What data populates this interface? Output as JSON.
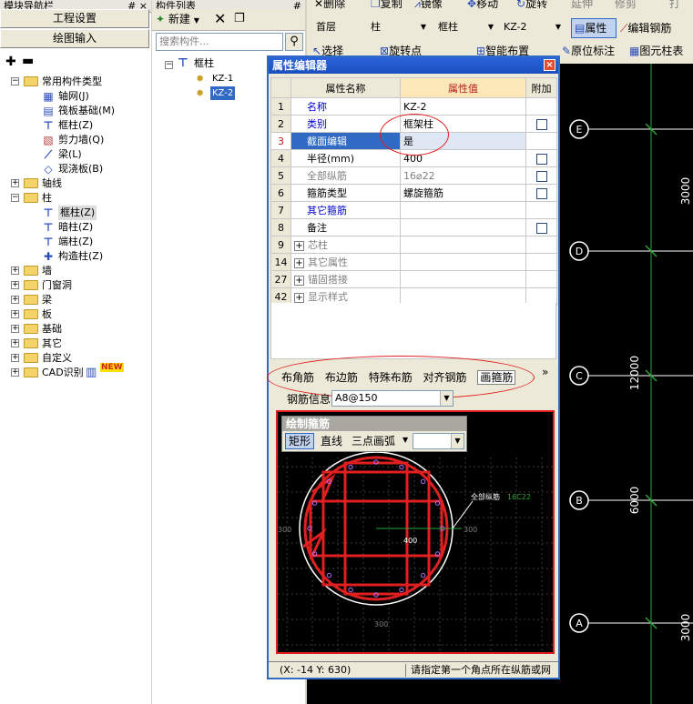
{
  "left_panel": {
    "title": "模块导航栏",
    "pin": "# ×",
    "buttons": [
      "工程设置",
      "绘图输入"
    ],
    "tree": [
      {
        "label": "常用构件类型",
        "level": 0,
        "folder": true,
        "expanded": true
      },
      {
        "label": "轴网(J)",
        "level": 1,
        "icon": "grid-icon"
      },
      {
        "label": "筏板基础(M)",
        "level": 1,
        "icon": "raft-foundation-icon"
      },
      {
        "label": "框柱(Z)",
        "level": 1,
        "icon": "frame-column-icon"
      },
      {
        "label": "剪力墙(Q)",
        "level": 1,
        "icon": "shear-wall-icon"
      },
      {
        "label": "梁(L)",
        "level": 1,
        "icon": "beam-icon"
      },
      {
        "label": "现浇板(B)",
        "level": 1,
        "icon": "slab-icon"
      },
      {
        "label": "轴线",
        "level": 0,
        "folder": true,
        "expanded": false
      },
      {
        "label": "柱",
        "level": 0,
        "folder": true,
        "expanded": true
      },
      {
        "label": "框柱(Z)",
        "level": 1,
        "icon": "frame-column-icon",
        "selected": true
      },
      {
        "label": "暗柱(Z)",
        "level": 1,
        "icon": "hidden-column-icon"
      },
      {
        "label": "端柱(Z)",
        "level": 1,
        "icon": "end-column-icon"
      },
      {
        "label": "构造柱(Z)",
        "level": 1,
        "icon": "constructional-column-icon"
      },
      {
        "label": "墙",
        "level": 0,
        "folder": true,
        "expanded": false
      },
      {
        "label": "门窗洞",
        "level": 0,
        "folder": true,
        "expanded": false
      },
      {
        "label": "梁",
        "level": 0,
        "folder": true,
        "expanded": false
      },
      {
        "label": "板",
        "level": 0,
        "folder": true,
        "expanded": false
      },
      {
        "label": "基础",
        "level": 0,
        "folder": true,
        "expanded": false
      },
      {
        "label": "其它",
        "level": 0,
        "folder": true,
        "expanded": false
      },
      {
        "label": "自定义",
        "level": 0,
        "folder": true,
        "expanded": false
      },
      {
        "label": "CAD识别",
        "level": 0,
        "folder": true,
        "expanded": false,
        "badge": "NEW"
      }
    ]
  },
  "component_list": {
    "title": "构件列表",
    "new_label": "新建",
    "search_placeholder": "搜索构件...",
    "root": "框柱",
    "items": [
      "KZ-1",
      "KZ-2"
    ]
  },
  "top_toolbar": {
    "row1": [
      "删除",
      "复制",
      "镜像",
      "移动",
      "旋转",
      "延伸",
      "修剪",
      "打"
    ],
    "floor": "首层",
    "category": "柱",
    "type": "框柱",
    "component": "KZ-2",
    "property_btn": "属性",
    "edit_rebar_btn": "编辑钢筋",
    "row3": [
      "选择",
      "旋转点",
      "智能布置",
      "原位标注",
      "图元柱表"
    ]
  },
  "property_editor": {
    "title": "属性编辑器",
    "close": "×",
    "headers": [
      "属性名称",
      "属性值",
      "附加"
    ],
    "rows": [
      {
        "num": "1",
        "name": "名称",
        "value": "KZ-2",
        "style": "blue",
        "check": false
      },
      {
        "num": "2",
        "name": "类别",
        "value": "框架柱",
        "style": "blue",
        "check": true
      },
      {
        "num": "3",
        "name": "截面编辑",
        "value": "是",
        "style": "selected",
        "check": false
      },
      {
        "num": "4",
        "name": "半径(mm)",
        "value": "400",
        "style": "normal",
        "check": true
      },
      {
        "num": "5",
        "name": "全部纵筋",
        "value": "16⌀22",
        "style": "gray",
        "check": true
      },
      {
        "num": "6",
        "name": "箍筋类型",
        "value": "螺旋箍筋",
        "style": "normal",
        "check": true
      },
      {
        "num": "7",
        "name": "其它箍筋",
        "value": "",
        "style": "blue",
        "check": false
      },
      {
        "num": "8",
        "name": "备注",
        "value": "",
        "style": "normal",
        "check": true
      },
      {
        "num": "9",
        "name": "芯柱",
        "value": "",
        "style": "group",
        "check": false
      },
      {
        "num": "14",
        "name": "其它属性",
        "value": "",
        "style": "group",
        "check": false
      },
      {
        "num": "27",
        "name": "锚固搭接",
        "value": "",
        "style": "group",
        "check": false
      },
      {
        "num": "42",
        "name": "显示样式",
        "value": "",
        "style": "group",
        "check": false
      }
    ],
    "tabs": [
      "布角筋",
      "布边筋",
      "特殊布筋",
      "对齐钢筋",
      "画箍筋"
    ],
    "more": "»",
    "rebar_info_label": "钢筋信息",
    "rebar_info_value": "A8@150",
    "draw_panel_title": "绘制箍筋",
    "draw_tools": [
      "矩形",
      "直线",
      "三点画弧"
    ],
    "canvas_labels": {
      "all_rebar": "全部纵筋",
      "all_rebar_value": "16C22",
      "radius": "400",
      "left": "300",
      "right": "300",
      "bottom": "300"
    },
    "status_coords": "(X: -14 Y: 630)",
    "status_msg": "请指定第一个角点所在纵筋或网"
  },
  "drawing_area": {
    "axis_labels": [
      "E",
      "D",
      "C",
      "B",
      "A"
    ],
    "dims": [
      "3000",
      "3000",
      "12000",
      "6000",
      "3000"
    ]
  },
  "colors": {
    "accent": "#316ac5",
    "annotation": "#e02020",
    "axis": "#2aa83a"
  }
}
